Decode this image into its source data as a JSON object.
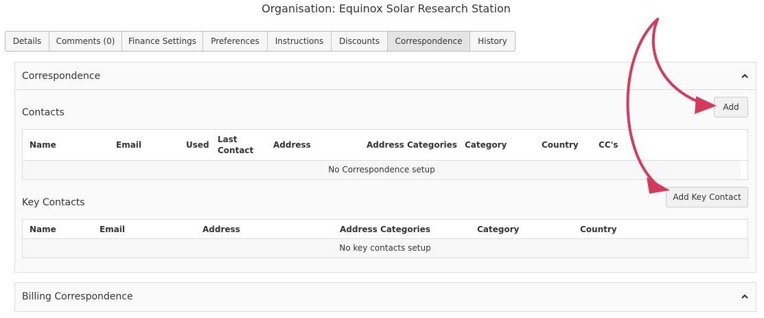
{
  "page": {
    "title": "Organisation: Equinox Solar Research Station"
  },
  "tabs": [
    {
      "label": "Details"
    },
    {
      "label": "Comments (0)"
    },
    {
      "label": "Finance Settings"
    },
    {
      "label": "Preferences"
    },
    {
      "label": "Instructions"
    },
    {
      "label": "Discounts"
    },
    {
      "label": "Correspondence"
    },
    {
      "label": "History"
    }
  ],
  "active_tab": "Correspondence",
  "correspondence": {
    "title": "Correspondence",
    "contacts": {
      "label": "Contacts",
      "add_button": "Add",
      "columns": [
        "Name",
        "Email",
        "Used",
        "Last Contact",
        "Address",
        "Address Categories",
        "Category",
        "Country",
        "CC's"
      ],
      "empty_text": "No Correspondence setup"
    },
    "key_contacts": {
      "label": "Key Contacts",
      "add_button": "Add Key Contact",
      "columns": [
        "Name",
        "Email",
        "Address",
        "Address Categories",
        "Category",
        "Country"
      ],
      "empty_text": "No key contacts setup"
    }
  },
  "billing": {
    "title": "Billing Correspondence"
  },
  "colors": {
    "annotation_arrow": "#d63a5a",
    "active_tab_bg": "#e4e4e4"
  },
  "icons": {
    "panel_toggle": "chevron-up-icon"
  }
}
